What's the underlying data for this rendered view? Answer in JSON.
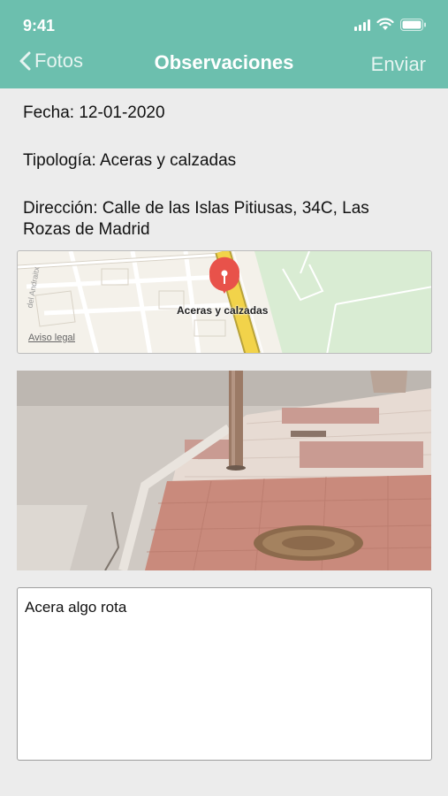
{
  "status_bar": {
    "time": "9:41"
  },
  "nav": {
    "back_label": "Fotos",
    "title": "Observaciones",
    "send_label": "Enviar"
  },
  "report": {
    "fecha": "Fecha: 12-01-2020",
    "tipologia": "Tipología: Aceras y calzadas",
    "direccion": "Dirección: Calle de las Islas Pitiusas, 34C, Las Rozas de Madrid"
  },
  "map": {
    "pin_label": "Aceras y calzadas",
    "legal_link": "Aviso legal",
    "street_label": "del Andraitx"
  },
  "notes": {
    "value": "Acera algo rota"
  },
  "colors": {
    "header": "#6cbfae",
    "background": "#ececec",
    "pin": "#e8524a"
  },
  "icons": {
    "back": "chevron-left-icon",
    "pin": "map-pin-icon",
    "signal": "cellular-signal-icon",
    "wifi": "wifi-icon",
    "battery": "battery-icon"
  }
}
